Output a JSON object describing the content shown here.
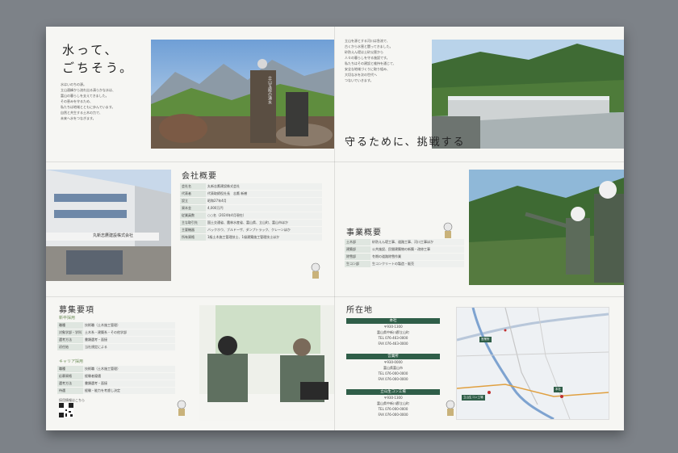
{
  "panel1": {
    "title_line1": "水って、",
    "title_line2": "ごちそう。",
    "body": [
      "水はいのちの源。",
      "立山連峰から流れ出る清らかな水は、",
      "富山の暮らしを支えてきました。",
      "その恵みを守るため、",
      "私たちは地域とともに歩んでいます。",
      "自然と共生する土木の力で、",
      "未来へ水をつなぎます。"
    ],
    "stone_text": "立山玉殿の湧水"
  },
  "panel2": {
    "body": [
      "立山を源とする河川は急流で、",
      "古くから水害と闘ってきました。",
      "砂防えん堤は土砂災害から",
      "人々の暮らしを守る施設です。",
      "私たちはその建設と維持を通じて、",
      "安全な地域づくりに取り組み、",
      "大切な水を次の世代へ",
      "つないでいきます。"
    ],
    "tagline": "守るために、挑戦する"
  },
  "company": {
    "title": "会社概要",
    "rows": [
      {
        "k": "会社名",
        "v": "丸新志鷹建設株式会社"
      },
      {
        "k": "代表者",
        "v": "代表取締役社長　志鷹 新樹"
      },
      {
        "k": "設立",
        "v": "昭和27年4月"
      },
      {
        "k": "資本金",
        "v": "4,000万円"
      },
      {
        "k": "従業員数",
        "v": "○○名（2024年4月現在）"
      },
      {
        "k": "主な取引先",
        "v": "国土交通省、農林水産省、富山県、立山町、富山市ほか"
      },
      {
        "k": "主要機器",
        "v": "バックホウ、ブルドーザ、ダンプトラック、クレーンほか"
      },
      {
        "k": "所有資格",
        "v": "1級土木施工管理技士、1級建築施工管理技士ほか"
      }
    ]
  },
  "business": {
    "title": "事業概要",
    "rows": [
      {
        "k": "土木部",
        "v": "砂防えん堤工事、道路工事、河川工事ほか"
      },
      {
        "k": "建築部",
        "v": "公共施設、民間建築物の新築・改修工事"
      },
      {
        "k": "除雪部",
        "v": "冬期の道路除雪作業"
      },
      {
        "k": "生コン部",
        "v": "生コンクリートの製造・販売"
      }
    ]
  },
  "recruit": {
    "title": "募集要項",
    "group1_label": "新卒採用",
    "group1_rows": [
      {
        "k": "職種",
        "v": "技術職（土木施工管理）"
      },
      {
        "k": "対象学部・学科",
        "v": "土木系・建築系・その他学部"
      },
      {
        "k": "選考方法",
        "v": "書類選考・面接"
      },
      {
        "k": "初任給",
        "v": "当社規定による"
      }
    ],
    "group2_label": "キャリア採用",
    "group2_rows": [
      {
        "k": "職種",
        "v": "技術職（土木施工管理）"
      },
      {
        "k": "応募資格",
        "v": "経験者優遇"
      },
      {
        "k": "選考方法",
        "v": "書類選考・面接"
      },
      {
        "k": "待遇",
        "v": "経験・能力を考慮し決定"
      }
    ],
    "qr_note": "採用情報はこちら"
  },
  "location": {
    "title": "所在地",
    "offices": [
      {
        "name": "本社",
        "lines": [
          "〒930-1300",
          "富山県中新川郡立山町",
          "TEL 076-463-0000",
          "FAX 076-463-0000"
        ]
      },
      {
        "name": "営業所",
        "lines": [
          "〒930-0000",
          "富山県富山市",
          "TEL 076-000-0000",
          "FAX 076-000-0000"
        ]
      },
      {
        "name": "立山生コン工場",
        "lines": [
          "〒930-1300",
          "富山県中新川郡立山町",
          "TEL 076-000-0000",
          "FAX 076-000-0000"
        ]
      }
    ],
    "map_labels": [
      "本社",
      "立山生コン工場",
      "営業所"
    ]
  },
  "building_sign": "丸新志鷹建設株式会社",
  "colors": {
    "green": "#2f5e48",
    "table_key": "#dfe6e0",
    "paper": "#f6f6f3",
    "background": "#7d8288"
  }
}
